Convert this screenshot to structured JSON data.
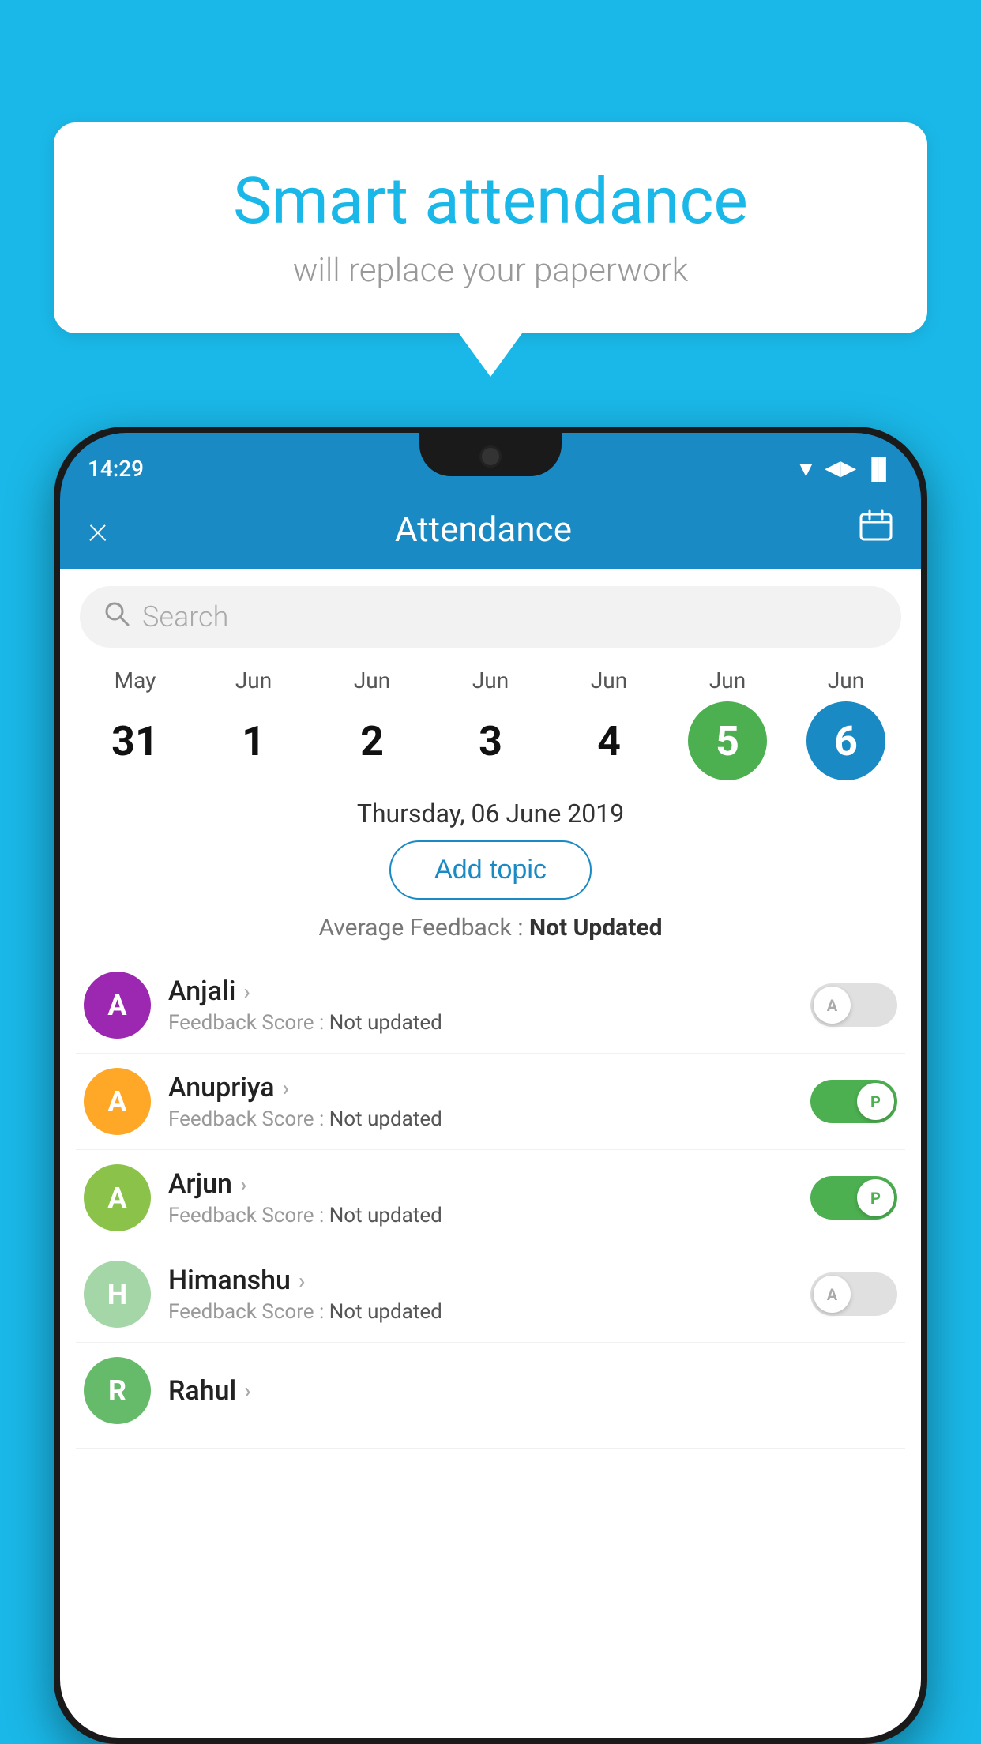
{
  "background_color": "#1ab8e8",
  "speech_bubble": {
    "title": "Smart attendance",
    "subtitle": "will replace your paperwork"
  },
  "status_bar": {
    "time": "14:29",
    "wifi": "▼",
    "signal": "▲",
    "battery": "▌"
  },
  "app_bar": {
    "title": "Attendance",
    "close_label": "×",
    "calendar_label": "📅"
  },
  "search": {
    "placeholder": "Search"
  },
  "dates": [
    {
      "month": "May",
      "day": "31",
      "state": "normal"
    },
    {
      "month": "Jun",
      "day": "1",
      "state": "normal"
    },
    {
      "month": "Jun",
      "day": "2",
      "state": "normal"
    },
    {
      "month": "Jun",
      "day": "3",
      "state": "normal"
    },
    {
      "month": "Jun",
      "day": "4",
      "state": "normal"
    },
    {
      "month": "Jun",
      "day": "5",
      "state": "today"
    },
    {
      "month": "Jun",
      "day": "6",
      "state": "selected"
    }
  ],
  "selected_date_label": "Thursday, 06 June 2019",
  "add_topic_label": "Add topic",
  "avg_feedback_label": "Average Feedback :",
  "avg_feedback_value": "Not Updated",
  "students": [
    {
      "name": "Anjali",
      "avatar_letter": "A",
      "avatar_color": "#9c27b0",
      "feedback_label": "Feedback Score :",
      "feedback_value": "Not updated",
      "attendance": "absent",
      "toggle_letter": "A"
    },
    {
      "name": "Anupriya",
      "avatar_letter": "A",
      "avatar_color": "#ffa726",
      "feedback_label": "Feedback Score :",
      "feedback_value": "Not updated",
      "attendance": "present",
      "toggle_letter": "P"
    },
    {
      "name": "Arjun",
      "avatar_letter": "A",
      "avatar_color": "#8bc34a",
      "feedback_label": "Feedback Score :",
      "feedback_value": "Not updated",
      "attendance": "present",
      "toggle_letter": "P"
    },
    {
      "name": "Himanshu",
      "avatar_letter": "H",
      "avatar_color": "#a5d6a7",
      "feedback_label": "Feedback Score :",
      "feedback_value": "Not updated",
      "attendance": "absent",
      "toggle_letter": "A"
    }
  ]
}
